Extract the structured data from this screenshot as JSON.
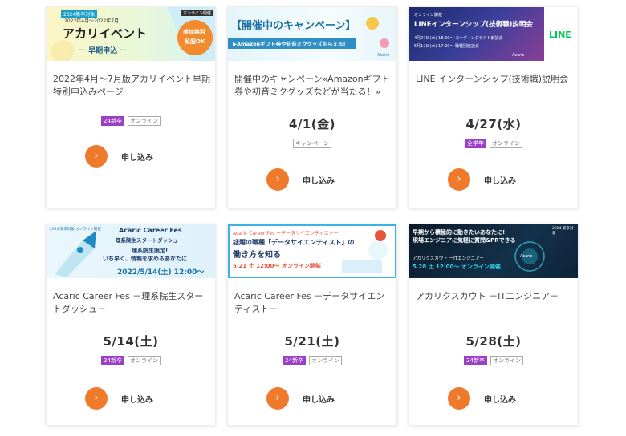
{
  "cards": [
    {
      "banner": {
        "badge": "2024新卒対象",
        "period": "2022年4月～2022年7月",
        "tag": "オンライン開催",
        "headline": "アカリイベント",
        "sub": "ー 早期申込 ー",
        "bubble1": "参加無料",
        "bubble2": "私服OK"
      },
      "title": "2022年4月～7月版アカリイベント早期特別申込みページ",
      "date": "",
      "tags": [
        "24新卒",
        "オンライン"
      ],
      "apply_label": "申し込み"
    },
    {
      "banner": {
        "headline": "【開催中のキャンペーン】",
        "sub": "▶Amazonギフト券や初音ミクグッズもらえる!",
        "logo": "Acaric"
      },
      "title": "開催中のキャンペーン«Amazonギフト券や初音ミクグッズなどが当たる！»",
      "date": "4/1(金)",
      "tags": [
        "キャンペーン"
      ],
      "apply_label": "申し込み"
    },
    {
      "banner": {
        "top": "オンライン開催",
        "headline": "LINEインターンシップ(技術職)説明会",
        "line1": "4月27日(水) 18:00～ コーディングテスト解説会",
        "line2": "5月12日(木) 17:00～ 職種別座談会",
        "logo": "Acaric",
        "brand": "LINE"
      },
      "title": "LINE インターンシップ(技術職)説明会",
      "date": "4/27(水)",
      "tags": [
        "全学年",
        "オンライン"
      ],
      "apply_label": "申し込み"
    },
    {
      "banner": {
        "badge": "2024 新卒対象 オンライン開催",
        "headline": "Acaric Career Fes",
        "sub": "理系院生スタートダッシュ",
        "line1": "理系院生限定!",
        "line2": "いち早く、情報を求めるあなたに",
        "date": "2022/5/14(土) 12:00～"
      },
      "title": "Acaric Career Fes －理系院生スタートダッシュ－",
      "date": "5/14(土)",
      "tags": [
        "24新卒",
        "オンライン"
      ],
      "apply_label": "申し込み"
    },
    {
      "banner": {
        "top": "Acaric Career Fes ーデータサイエンティストー",
        "headline": "話題の職種「データサイエンティスト」の",
        "sub": "働き方を知る",
        "date": "5.21 土 12:00～ オンライン開催"
      },
      "title": "Acaric Career Fes －データサイエンティスト－",
      "date": "5/21(土)",
      "tags": [
        "24新卒",
        "オンライン"
      ],
      "apply_label": "申し込み"
    },
    {
      "banner": {
        "line1": "早期から積極的に動きたいあなたに!",
        "line2": "現場エンジニアに気軽に質問&PRできる",
        "badge": "2024 新卒対象",
        "scout": "アカリクスカウト ーITエンジニアー",
        "date": "5.28 土 12:00～ オンライン開催",
        "logo": "Acaric"
      },
      "title": "アカリクスカウト －ITエンジニア－",
      "date": "5/28(土)",
      "tags": [
        "24新卒",
        "オンライン"
      ],
      "apply_label": "申し込み"
    }
  ],
  "colors": {
    "accent": "#f07a2c",
    "tag_purple": "#9b3fc6"
  },
  "icons": {
    "apply": "chevron-right-icon"
  }
}
